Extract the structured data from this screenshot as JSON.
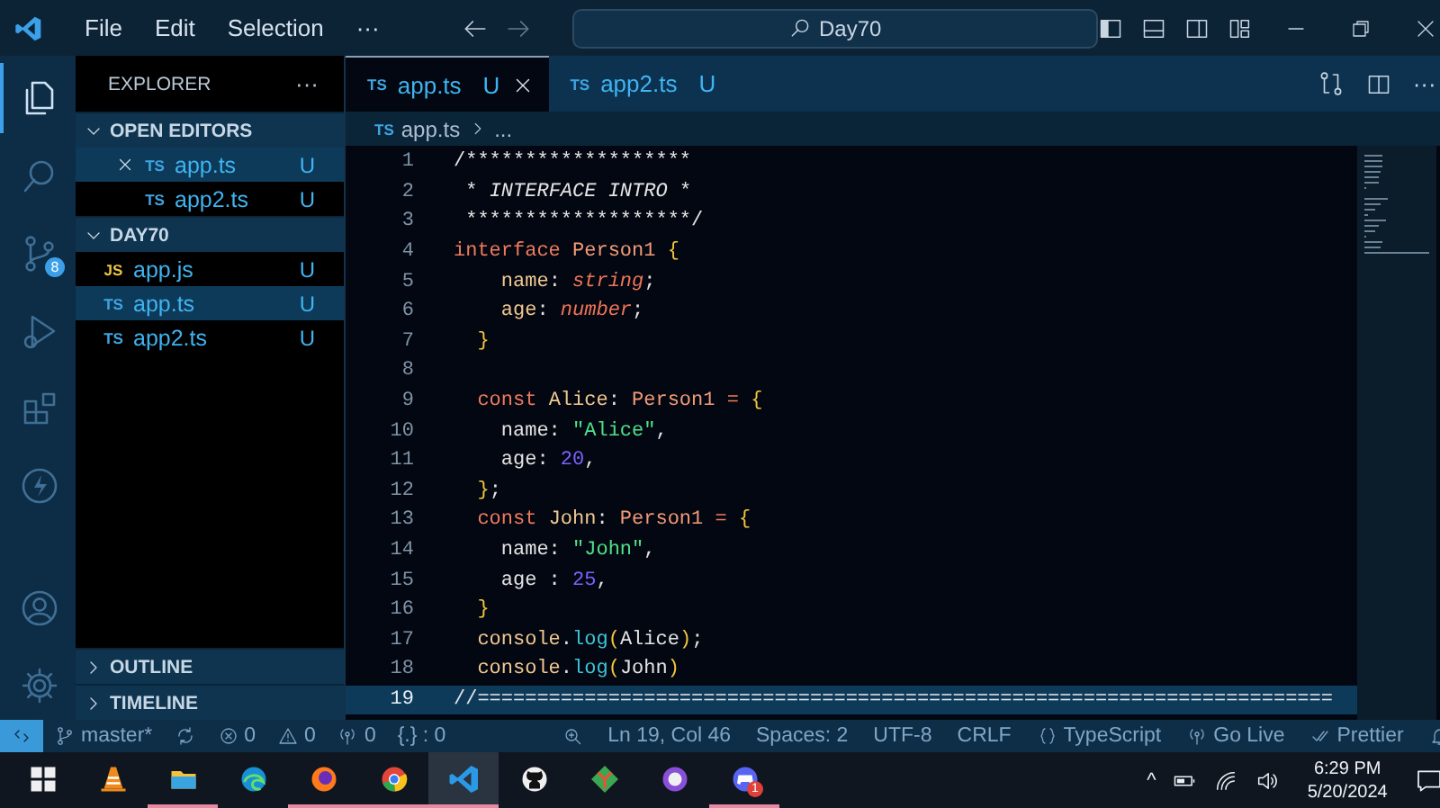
{
  "title_bar": {
    "menus": [
      "File",
      "Edit",
      "Selection",
      "···"
    ],
    "search": "Day70"
  },
  "activity_bar": {
    "top": [
      {
        "selected": true
      },
      {
        "selected": false
      },
      {
        "selected": false,
        "badge": "8"
      },
      {
        "selected": false
      },
      {
        "selected": false
      },
      {
        "selected": false
      }
    ],
    "bottom": [
      {
        "selected": false
      },
      {
        "selected": false
      }
    ]
  },
  "explorer": {
    "title": "EXPLORER",
    "more": "···",
    "open_editors": {
      "label": "OPEN EDITORS",
      "expanded": true,
      "items": [
        {
          "kind": "ts",
          "lang": "TS",
          "name": "app.ts",
          "status": "U",
          "selected": true
        },
        {
          "kind": "ts",
          "lang": "TS",
          "name": "app2.ts",
          "status": "U",
          "selected": false
        }
      ]
    },
    "folder": {
      "label": "DAY70",
      "expanded": true,
      "files": [
        {
          "kind": "js",
          "lang": "JS",
          "name": "app.js",
          "status": "U",
          "selected": false
        },
        {
          "kind": "ts",
          "lang": "TS",
          "name": "app.ts",
          "status": "U",
          "selected": true
        },
        {
          "kind": "ts",
          "lang": "TS",
          "name": "app2.ts",
          "status": "U",
          "selected": false
        }
      ]
    },
    "sections": [
      {
        "label": "OUTLINE",
        "expanded": false
      },
      {
        "label": "TIMELINE",
        "expanded": false
      }
    ]
  },
  "tabs": [
    {
      "kind": "ts",
      "lang": "TS",
      "name": "app.ts",
      "status": "U",
      "selected": true
    },
    {
      "kind": "ts",
      "lang": "TS",
      "name": "app2.ts",
      "status": "U",
      "selected": false
    }
  ],
  "tab_actions": {
    "more": "···"
  },
  "breadcrumb": {
    "lang": "TS",
    "file": "app.ts",
    "rest": "..."
  },
  "editor": {
    "lines": [
      {
        "number": "1",
        "current": false,
        "tokens": [
          {
            "kind": "comment",
            "text": "/*******************"
          }
        ]
      },
      {
        "number": "2",
        "current": false,
        "tokens": [
          {
            "kind": "comment",
            "text": " * "
          },
          {
            "kind": "comment-italic",
            "text": "INTERFACE INTRO"
          },
          {
            "kind": "comment",
            "text": " *"
          }
        ]
      },
      {
        "number": "3",
        "current": false,
        "tokens": [
          {
            "kind": "comment",
            "text": " *******************/"
          }
        ]
      },
      {
        "number": "4",
        "current": false,
        "tokens": [
          {
            "kind": "keyword",
            "text": "interface "
          },
          {
            "kind": "typename",
            "text": "Person1 "
          },
          {
            "kind": "brace",
            "text": "{"
          }
        ]
      },
      {
        "number": "5",
        "current": false,
        "tokens": [
          {
            "kind": "prop",
            "text": "    name"
          },
          {
            "kind": "plain",
            "text": ": "
          },
          {
            "kind": "type",
            "text": "string"
          },
          {
            "kind": "plain",
            "text": ";"
          }
        ]
      },
      {
        "number": "6",
        "current": false,
        "tokens": [
          {
            "kind": "prop",
            "text": "    age"
          },
          {
            "kind": "plain",
            "text": ": "
          },
          {
            "kind": "type",
            "text": "number"
          },
          {
            "kind": "plain",
            "text": ";"
          }
        ]
      },
      {
        "number": "7",
        "current": false,
        "tokens": [
          {
            "kind": "brace",
            "text": "  }"
          }
        ]
      },
      {
        "number": "8",
        "current": false
      },
      {
        "number": "9",
        "current": false,
        "tokens": [
          {
            "kind": "keyword",
            "text": "  const "
          },
          {
            "kind": "prop",
            "text": "Alice"
          },
          {
            "kind": "plain",
            "text": ": "
          },
          {
            "kind": "typename",
            "text": "Person1"
          },
          {
            "kind": "keyword",
            "text": " = "
          },
          {
            "kind": "brace",
            "text": "{"
          }
        ]
      },
      {
        "number": "10",
        "current": false,
        "tokens": [
          {
            "kind": "plain",
            "text": "    name: "
          },
          {
            "kind": "string",
            "text": "\"Alice\""
          },
          {
            "kind": "plain",
            "text": ","
          }
        ]
      },
      {
        "number": "11",
        "current": false,
        "tokens": [
          {
            "kind": "plain",
            "text": "    age: "
          },
          {
            "kind": "number",
            "text": "20"
          },
          {
            "kind": "plain",
            "text": ","
          }
        ]
      },
      {
        "number": "12",
        "current": false,
        "tokens": [
          {
            "kind": "brace",
            "text": "  }"
          },
          {
            "kind": "plain",
            "text": ";"
          }
        ]
      },
      {
        "number": "13",
        "current": false,
        "tokens": [
          {
            "kind": "keyword",
            "text": "  const "
          },
          {
            "kind": "prop",
            "text": "John"
          },
          {
            "kind": "plain",
            "text": ": "
          },
          {
            "kind": "typename",
            "text": "Person1"
          },
          {
            "kind": "keyword",
            "text": " = "
          },
          {
            "kind": "brace",
            "text": "{"
          }
        ]
      },
      {
        "number": "14",
        "current": false,
        "tokens": [
          {
            "kind": "plain",
            "text": "    name: "
          },
          {
            "kind": "string",
            "text": "\"John\""
          },
          {
            "kind": "plain",
            "text": ","
          }
        ]
      },
      {
        "number": "15",
        "current": false,
        "tokens": [
          {
            "kind": "plain",
            "text": "    age : "
          },
          {
            "kind": "number",
            "text": "25"
          },
          {
            "kind": "plain",
            "text": ","
          }
        ]
      },
      {
        "number": "16",
        "current": false,
        "tokens": [
          {
            "kind": "brace",
            "text": "  }"
          }
        ]
      },
      {
        "number": "17",
        "current": false,
        "tokens": [
          {
            "kind": "prop",
            "text": "  console"
          },
          {
            "kind": "plain",
            "text": "."
          },
          {
            "kind": "method",
            "text": "log"
          },
          {
            "kind": "brace",
            "text": "("
          },
          {
            "kind": "plain",
            "text": "Alice"
          },
          {
            "kind": "brace",
            "text": ")"
          },
          {
            "kind": "plain",
            "text": ";"
          }
        ]
      },
      {
        "number": "18",
        "current": false,
        "tokens": [
          {
            "kind": "prop",
            "text": "  console"
          },
          {
            "kind": "plain",
            "text": "."
          },
          {
            "kind": "method",
            "text": "log"
          },
          {
            "kind": "brace",
            "text": "("
          },
          {
            "kind": "plain",
            "text": "John"
          },
          {
            "kind": "brace",
            "text": ")"
          }
        ]
      },
      {
        "number": "19",
        "current": true,
        "tokens": [
          {
            "kind": "comment",
            "text": "//========================================================================"
          }
        ]
      }
    ]
  },
  "status_bar": {
    "left": [
      {
        "text": "master*"
      },
      {
        "text": "0"
      },
      {
        "text": "0"
      },
      {
        "text": "0"
      },
      {
        "text": "{.} : 0"
      }
    ],
    "right": [
      {
        "text": "Ln 19, Col 46"
      },
      {
        "text": "Spaces: 2"
      },
      {
        "text": "UTF-8"
      },
      {
        "text": "CRLF"
      },
      {
        "text": "TypeScript"
      },
      {
        "text": "Go Live"
      },
      {
        "text": "Prettier"
      }
    ]
  },
  "taskbar": {
    "apps": [
      {
        "running": false,
        "active": false
      },
      {
        "running": false,
        "active": false
      },
      {
        "running": true,
        "active": false
      },
      {
        "running": false,
        "active": false
      },
      {
        "running": true,
        "active": false
      },
      {
        "running": true,
        "active": false
      },
      {
        "running": true,
        "active": true
      },
      {
        "running": false,
        "active": false
      },
      {
        "running": false,
        "active": false
      },
      {
        "running": false,
        "active": false
      },
      {
        "running": true,
        "active": false,
        "badge": "1"
      }
    ],
    "tray": {
      "caret": "^",
      "time": "6:29 PM",
      "date": "5/20/2024"
    }
  }
}
